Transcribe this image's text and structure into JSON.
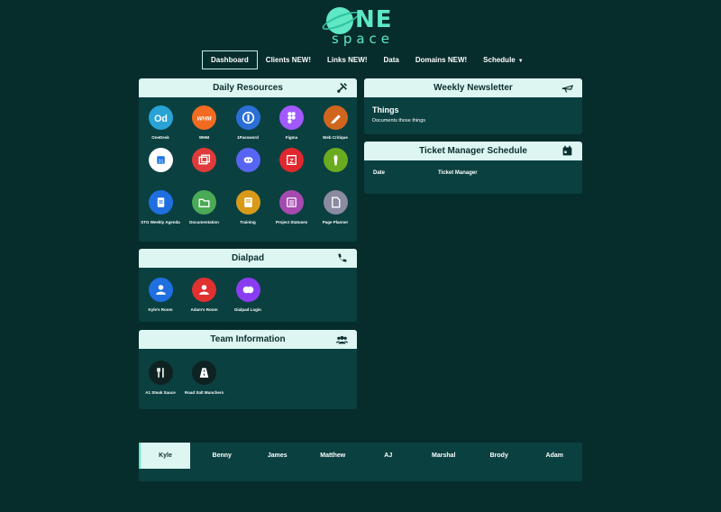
{
  "logo": {
    "word_one": "NE",
    "word_two": "space"
  },
  "nav": {
    "items": [
      {
        "label": "Dashboard"
      },
      {
        "label": "Clients NEW!"
      },
      {
        "label": "Links NEW!"
      },
      {
        "label": "Data"
      },
      {
        "label": "Domains NEW!"
      },
      {
        "label": "Schedule"
      }
    ]
  },
  "daily_resources": {
    "title": "Daily Resources",
    "icon": "tools-icon",
    "tiles": [
      {
        "label": "OneDesk",
        "color": "#29a3d6"
      },
      {
        "label": "WHM",
        "color": "#f26b21"
      },
      {
        "label": "1Password",
        "color": "#2b6fd6"
      },
      {
        "label": "Figma",
        "color": "#a259ff"
      },
      {
        "label": "Web Critique",
        "color": "#d0661e"
      },
      {
        "label": "",
        "color": "#ffffff"
      },
      {
        "label": "",
        "color": "#e03a3a"
      },
      {
        "label": "",
        "color": "#5865f2"
      },
      {
        "label": "",
        "color": "#e0282e"
      },
      {
        "label": "",
        "color": "#6aab1f"
      },
      {
        "label": "STG Weekly Agenda",
        "color": "#1f6fe0"
      },
      {
        "label": "Documentation",
        "color": "#4aaa55"
      },
      {
        "label": "Training",
        "color": "#d99a1a"
      },
      {
        "label": "Project Statuses",
        "color": "#a64ab0"
      },
      {
        "label": "Page Planner",
        "color": "#8a8aa0"
      }
    ]
  },
  "dialpad": {
    "title": "Dialpad",
    "icon": "phone-icon",
    "tiles": [
      {
        "label": "Kyle's Room",
        "color": "#1f6fe0"
      },
      {
        "label": "Adam's Room",
        "color": "#e03030"
      },
      {
        "label": "Dialpad Login",
        "color": "#8a3df0"
      }
    ]
  },
  "team_info": {
    "title": "Team Information",
    "icon": "users-icon",
    "tiles": [
      {
        "label": "A1 Steak Sauce",
        "color": "#0f2222"
      },
      {
        "label": "Road Salt Munchers",
        "color": "#0f2222"
      }
    ]
  },
  "newsletter": {
    "title": "Weekly Newsletter",
    "icon": "plane-icon",
    "heading": "Things",
    "body": "Documents those things"
  },
  "ticket_schedule": {
    "title": "Ticket Manager Schedule",
    "icon": "calendar-icon",
    "columns": [
      "Date",
      "Ticket Manager"
    ]
  },
  "people_tabs": {
    "items": [
      "Kyle",
      "Benny",
      "James",
      "Matthew",
      "AJ",
      "Marshal",
      "Brody",
      "Adam"
    ],
    "active": "Kyle"
  }
}
